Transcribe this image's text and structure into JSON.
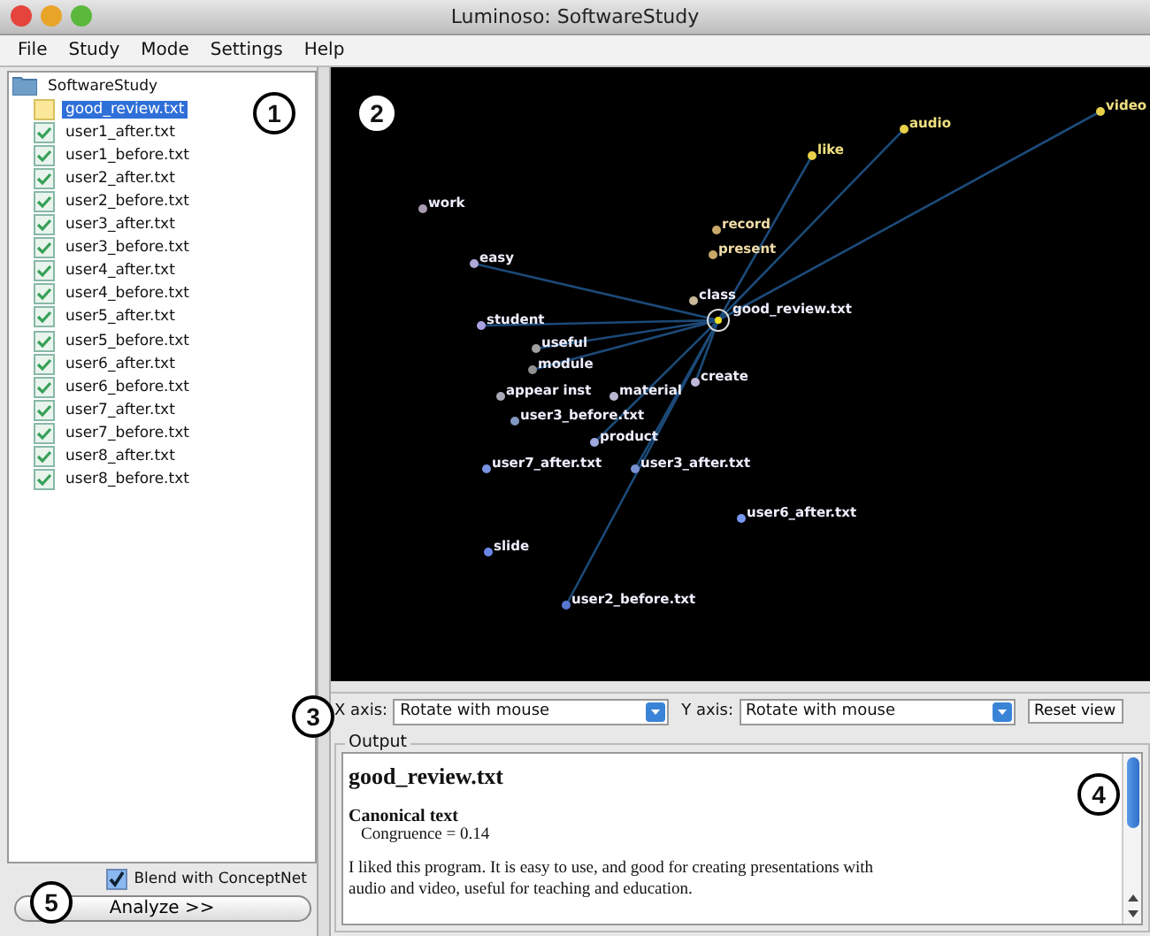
{
  "window": {
    "title": "Luminoso: SoftwareStudy"
  },
  "menu": [
    "File",
    "Study",
    "Mode",
    "Settings",
    "Help"
  ],
  "tree": {
    "label": "SoftwareStudy",
    "children": [
      {
        "label": "good_review.txt",
        "checked": false,
        "selected": true
      },
      {
        "label": "user1_after.txt",
        "checked": true,
        "selected": false
      },
      {
        "label": "user1_before.txt",
        "checked": true,
        "selected": false
      },
      {
        "label": "user2_after.txt",
        "checked": true,
        "selected": false
      },
      {
        "label": "user2_before.txt",
        "checked": true,
        "selected": false
      },
      {
        "label": "user3_after.txt",
        "checked": true,
        "selected": false
      },
      {
        "label": "user3_before.txt",
        "checked": true,
        "selected": false
      },
      {
        "label": "user4_after.txt",
        "checked": true,
        "selected": false
      },
      {
        "label": "user4_before.txt",
        "checked": true,
        "selected": false
      },
      {
        "label": "user5_after.txt",
        "checked": true,
        "selected": false
      },
      {
        "label": "user5_before.txt",
        "checked": true,
        "selected": false
      },
      {
        "label": "user6_after.txt",
        "checked": true,
        "selected": false
      },
      {
        "label": "user6_before.txt",
        "checked": true,
        "selected": false
      },
      {
        "label": "user7_after.txt",
        "checked": true,
        "selected": false
      },
      {
        "label": "user7_before.txt",
        "checked": true,
        "selected": false
      },
      {
        "label": "user8_after.txt",
        "checked": true,
        "selected": false
      },
      {
        "label": "user8_before.txt",
        "checked": true,
        "selected": false
      }
    ]
  },
  "blend": {
    "label": "Blend with ConceptNet",
    "checked": true
  },
  "analyze_button": "Analyze >>",
  "plot": {
    "points": [
      {
        "label": "video",
        "color": "#e8d04a"
      },
      {
        "label": "audio",
        "color": "#e8d04a"
      },
      {
        "label": "like",
        "color": "#e8d04a"
      },
      {
        "label": "work",
        "color": "#a89ab0"
      },
      {
        "label": "record",
        "color": "#c8a868"
      },
      {
        "label": "present",
        "color": "#c8a868"
      },
      {
        "label": "easy",
        "color": "#b0a8d8"
      },
      {
        "label": "class",
        "color": "#c8b898"
      },
      {
        "label": "student",
        "color": "#a8a0e0"
      },
      {
        "label": "good_review.txt",
        "color": "#f0e020"
      },
      {
        "label": "useful",
        "color": "#a0a0a0"
      },
      {
        "label": "module",
        "color": "#909090"
      },
      {
        "label": "create",
        "color": "#c0b8d8"
      },
      {
        "label": "appear inst",
        "color": "#a8a8b8"
      },
      {
        "label": "material",
        "color": "#b8b8d0"
      },
      {
        "label": "user3_before.txt",
        "color": "#8098c0"
      },
      {
        "label": "product",
        "color": "#a0a8e0"
      },
      {
        "label": "user7_after.txt",
        "color": "#7890e0"
      },
      {
        "label": "user3_after.txt",
        "color": "#7890d0"
      },
      {
        "label": "user6_after.txt",
        "color": "#7898f0"
      },
      {
        "label": "slide",
        "color": "#6888e8"
      },
      {
        "label": "user2_before.txt",
        "color": "#5878d0"
      }
    ]
  },
  "x_axis": {
    "label": "X axis:",
    "value": "Rotate with mouse"
  },
  "y_axis": {
    "label": "Y axis:",
    "value": "Rotate with mouse"
  },
  "reset_button": "Reset view",
  "output": {
    "title": "Output",
    "heading": "good_review.txt",
    "subheading": "Canonical text",
    "congruence": "Congruence = 0.14",
    "body": "I liked this program. It is easy to use, and good for creating presentations with audio and video, useful for teaching and education."
  },
  "callouts": [
    "1",
    "2",
    "3",
    "4",
    "5"
  ]
}
